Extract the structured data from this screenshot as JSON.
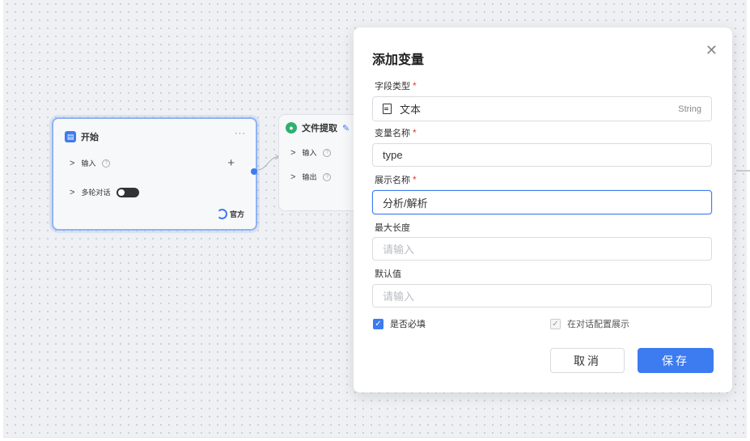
{
  "canvas": {
    "start_node": {
      "title": "开始",
      "badge": "☰",
      "more": "···",
      "input_label": "输入",
      "multi_turn_label": "多轮对话",
      "official_label": "官方"
    },
    "extract_node": {
      "title": "文件提取",
      "input_label": "输入",
      "output_label": "输出"
    }
  },
  "modal": {
    "title": "添加变量",
    "close_icon": "close-icon",
    "fields": {
      "field_type": {
        "label": "字段类型",
        "value": "文本",
        "suffix": "String"
      },
      "var_name": {
        "label": "变量名称",
        "value": "type"
      },
      "display_name": {
        "label": "展示名称",
        "value": "分析/解析"
      },
      "max_length": {
        "label": "最大长度",
        "placeholder": "请输入"
      },
      "default_value": {
        "label": "默认值",
        "placeholder": "请输入"
      }
    },
    "required_mark": "*",
    "checkboxes": {
      "required": {
        "label": "是否必填",
        "checked": true
      },
      "show_in_dialog": {
        "label": "在对话配置展示",
        "checked": true,
        "disabled": true
      }
    },
    "buttons": {
      "cancel": "取消",
      "save": "保存"
    }
  },
  "colors": {
    "accent": "#3d7bf0",
    "required": "#e03b3b"
  }
}
